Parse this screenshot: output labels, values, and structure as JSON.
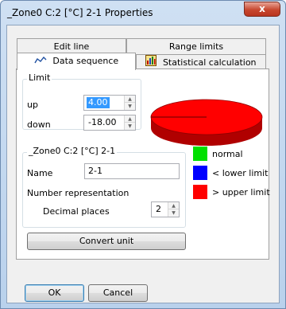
{
  "window": {
    "title": "_Zone0 C:2 [°C] 2-1 Properties",
    "close_label": "x"
  },
  "tabs": {
    "back_row": [
      {
        "label": "Edit line"
      },
      {
        "label": "Range limits"
      }
    ],
    "front_row": [
      {
        "label": "Data sequence",
        "icon": "line-chart-icon",
        "active": true
      },
      {
        "label": "Statistical calculation",
        "icon": "statistics-icon",
        "active": false
      }
    ]
  },
  "limit": {
    "group_label": "Limit",
    "up_label": "up",
    "up_value": "4.00",
    "down_label": "down",
    "down_value": "-18.00"
  },
  "channel": {
    "group_label": "_Zone0 C:2 [°C] 2-1",
    "name_label": "Name",
    "name_value": "2-1",
    "number_representation_label": "Number representation",
    "decimal_places_label": "Decimal places",
    "decimal_places_value": "2"
  },
  "convert_unit_label": "Convert unit",
  "pie": {
    "slices": [
      {
        "name": "> upper limit",
        "fraction": 1.0,
        "color": "#ff0000"
      }
    ]
  },
  "legend": [
    {
      "label": "normal",
      "color": "#00e000"
    },
    {
      "label": "< lower limit",
      "color": "#0000ff"
    },
    {
      "label": "> upper limit",
      "color": "#ff0000"
    }
  ],
  "footer": {
    "ok_label": "OK",
    "cancel_label": "Cancel"
  }
}
